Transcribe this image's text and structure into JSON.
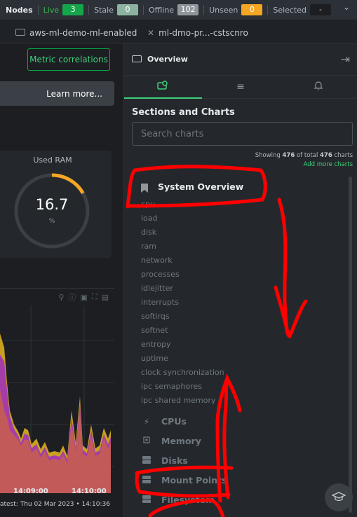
{
  "topbar": {
    "nodes_label": "Nodes",
    "live_label": "Live",
    "live_count": "3",
    "stale_label": "Stale",
    "stale_count": "0",
    "offline_label": "Offline",
    "offline_count": "102",
    "unseen_label": "Unseen",
    "unseen_count": "0",
    "selected_label": "Selected",
    "selected_value": "-"
  },
  "tabs": [
    {
      "label": "aws-ml-demo-ml-enabled",
      "icon": "window-icon"
    },
    {
      "label": "ml-dmo-pr...-cstscnro",
      "icon": "close-icon"
    }
  ],
  "left": {
    "metric_button": "Metric correlations",
    "learn_more": "Learn more...",
    "gauge": {
      "title": "Used RAM",
      "value": "16.7",
      "unit": "%",
      "fraction": 0.167
    },
    "time_labels": [
      "14:09:00",
      "14:10:00"
    ],
    "latest": "atest: Thu 02 Mar 2023 • 14:10:36"
  },
  "panel": {
    "title": "Overview",
    "sections_title": "Sections and Charts",
    "search_placeholder": "Search charts",
    "showing_prefix": "Showing",
    "showing_count": "476",
    "showing_mid": "of total",
    "showing_total": "476",
    "showing_suffix": "charts",
    "add_more": "Add more charts",
    "system_overview": "System Overview",
    "subitems": [
      "cpu",
      "load",
      "disk",
      "ram",
      "network",
      "processes",
      "idlejitter",
      "interrupts",
      "softirqs",
      "softnet",
      "entropy",
      "uptime",
      "clock synchronization",
      "ipc semaphores",
      "ipc shared memory"
    ],
    "groups": [
      {
        "label": "CPUs",
        "icon": "bolt-icon"
      },
      {
        "label": "Memory",
        "icon": "chip-icon"
      },
      {
        "label": "Disks",
        "icon": "disk-icon"
      },
      {
        "label": "Mount Points",
        "icon": "disk-icon"
      },
      {
        "label": "Filesystem",
        "icon": "disk-icon"
      }
    ]
  },
  "colors": {
    "accent": "#00ab44",
    "gauge": "#f5a623",
    "annotation": "#ff0000"
  }
}
